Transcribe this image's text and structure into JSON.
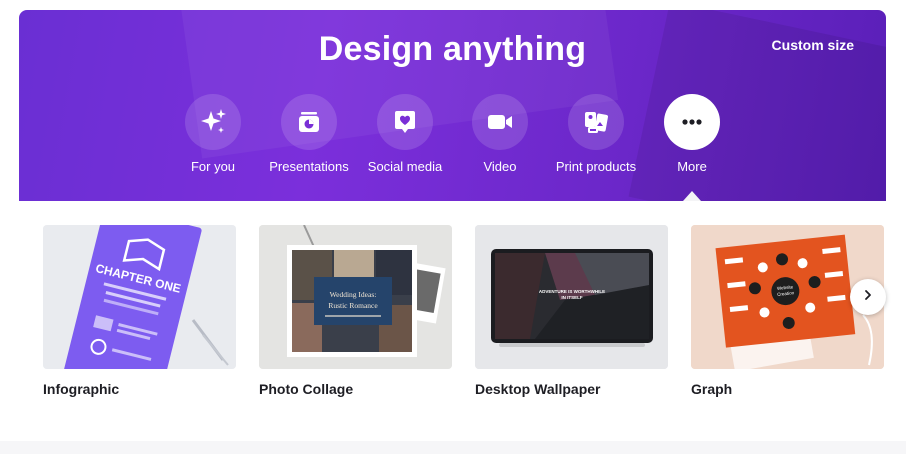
{
  "hero": {
    "title": "Design anything",
    "custom_size": "Custom size"
  },
  "categories": [
    {
      "label": "For you",
      "icon": "sparkle-icon"
    },
    {
      "label": "Presentations",
      "icon": "presentation-icon"
    },
    {
      "label": "Social media",
      "icon": "heart-chat-icon"
    },
    {
      "label": "Video",
      "icon": "video-camera-icon"
    },
    {
      "label": "Print products",
      "icon": "print-products-icon"
    },
    {
      "label": "More",
      "icon": "more-dots-icon",
      "active": true
    }
  ],
  "cards": [
    {
      "label": "Infographic",
      "thumb_text": [
        "CHAPTER ONE"
      ]
    },
    {
      "label": "Photo Collage",
      "thumb_text": [
        "Wedding Ideas:",
        "Rustic Romance"
      ]
    },
    {
      "label": "Desktop Wallpaper",
      "thumb_text": [
        "ADVENTURE IS WORTHWHILE",
        "IN ITSELF"
      ]
    },
    {
      "label": "Graph",
      "thumb_text": [
        "Website",
        "Creation"
      ]
    }
  ],
  "colors": {
    "hero_start": "#6a2fd3",
    "hero_end": "#5a1fb8",
    "infographic_purple": "#7d5cf0",
    "graph_orange": "#e3541f"
  }
}
